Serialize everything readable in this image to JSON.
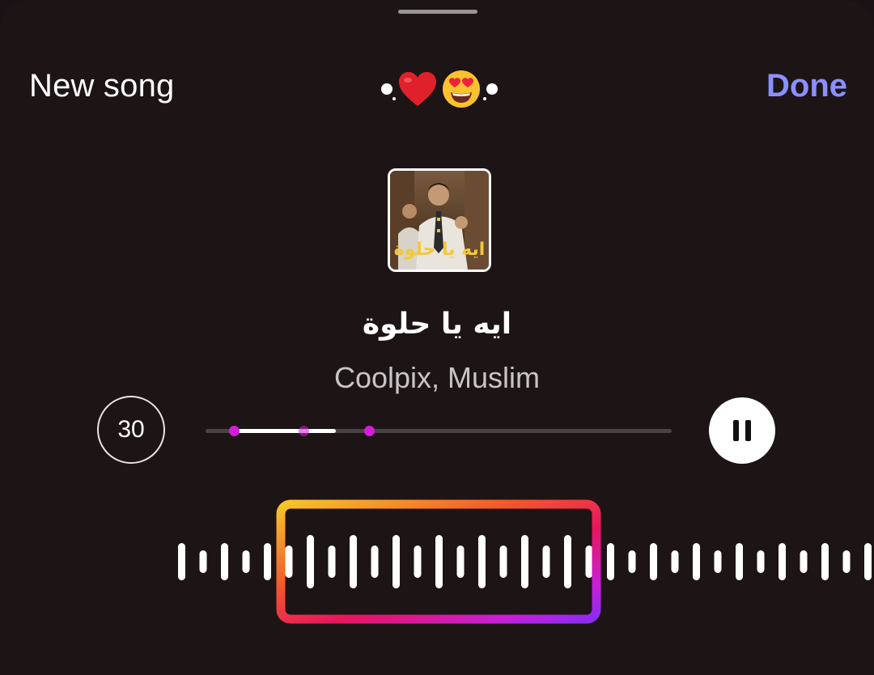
{
  "header": {
    "left_label": "New song",
    "right_label": "Done",
    "title_icons": [
      "dot",
      "heart-emoji",
      "heart-eyes-emoji",
      "dot"
    ]
  },
  "track": {
    "cover_text": "ايه يا حلوة",
    "title": "ايه يا حلوة",
    "artists": "Coolpix, Muslim"
  },
  "player": {
    "duration": "30",
    "progress": 0.22,
    "markers": [
      0.06,
      0.21,
      0.35
    ],
    "pause_icon": "pause-icon"
  },
  "colors": {
    "background": "#1d1416",
    "accent": "#8b8fff",
    "marker": "#d21ed6",
    "selection_gradient": [
      "#f7c52a",
      "#f25a2a",
      "#e8155d",
      "#c81fd8",
      "#8a2cf0"
    ]
  }
}
